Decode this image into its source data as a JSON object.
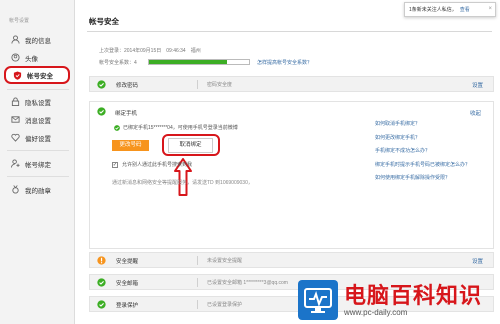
{
  "sidebar": {
    "heading": "帐号设置",
    "items": [
      {
        "label": "我的信息",
        "icon": "user-icon"
      },
      {
        "label": "头像",
        "icon": "avatar-icon"
      },
      {
        "label": "帐号安全",
        "icon": "shield-icon",
        "active": true
      },
      {
        "label": "隐私设置",
        "icon": "lock-icon"
      },
      {
        "label": "消息设置",
        "icon": "message-icon"
      },
      {
        "label": "偏好设置",
        "icon": "heart-icon"
      },
      {
        "label": "帐号绑定",
        "icon": "link-user-icon"
      },
      {
        "label": "我的勋章",
        "icon": "medal-icon"
      }
    ]
  },
  "main": {
    "title": "帐号安全",
    "last_login": "上次登录：2014年09月15日　09:46:34　福州",
    "security_label": "帐号安全系数：4",
    "security_level": 0.78,
    "improve_link": "怎样提高帐号安全系数？",
    "rows_top": [
      {
        "label": "修改密码",
        "status": "密码安全度",
        "action": "设置"
      }
    ],
    "phone_panel": {
      "title": "绑定手机",
      "collapse": "收起",
      "status": "已绑定手机15*******04，可使用手机号登录当前微博",
      "change_button": "更改号码",
      "unbind_button": "取消绑定",
      "allow_label": "允许别人通过此手机号搜索到我",
      "allow_checked": true,
      "notify_text": "通过新消息和网络安全等提醒服务，请发送TD 到1069009030，"
    },
    "help_links": [
      "如何取消手机绑定？",
      "如何更改绑定手机？",
      "手机绑定不成功怎么办？",
      "绑定手机时提示手机号码已被绑定怎么办？",
      "如何使用绑定手机解除操作受限？"
    ],
    "rows_bottom": [
      {
        "label": "安全提醒",
        "status": "未设置安全提醒",
        "action": "设置"
      },
      {
        "label": "安全邮箱",
        "status": "已设置安全邮箱 1*********3@qq.com",
        "action": ""
      },
      {
        "label": "登录保护",
        "status": "已设置登录保护",
        "action": ""
      }
    ]
  },
  "popup": {
    "text": "1条新未关注人私信，",
    "link": "查看",
    "close": "×"
  },
  "watermark": {
    "cn": "电脑百科知识",
    "en": "www.pc-daily.com"
  },
  "colors": {
    "accent_red": "#d7161b",
    "link_blue": "#3a6ea5",
    "green": "#3cae24",
    "orange": "#f7941d"
  }
}
